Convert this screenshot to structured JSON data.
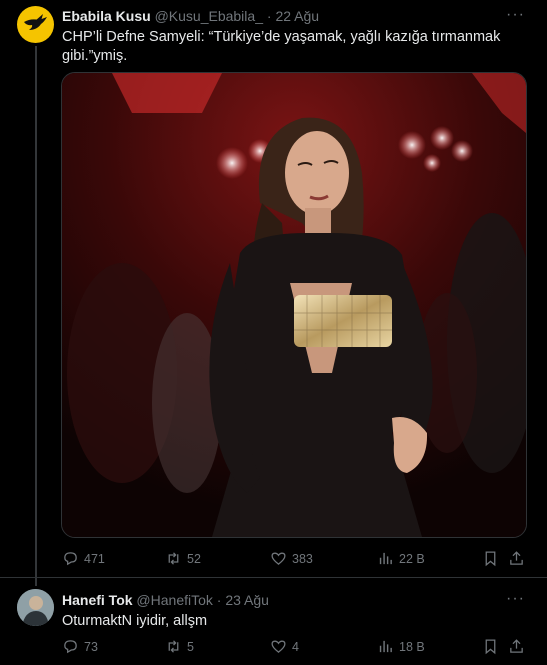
{
  "tweet1": {
    "name": "Ebabila Kusu",
    "handle": "@Kusu_Ebabila_",
    "date": "22 Ağu",
    "text_line1": "CHP’li Defne Samyeli: “Türkiye’de yaşamak, yağlı kazığa tırmanmak",
    "text_line2": "gibi.”ymiş.",
    "replies": "471",
    "retweets": "52",
    "likes": "383",
    "views": "22 B"
  },
  "tweet2": {
    "name": "Hanefi Tok",
    "handle": "@HanefiTok",
    "date": "23 Ağu",
    "text": "OturmaktN iyidir, allşm",
    "replies": "73",
    "retweets": "5",
    "likes": "4",
    "views": "18 B"
  },
  "ui": {
    "dot": "·",
    "more": "···"
  },
  "colors": {
    "background": "#000000",
    "text": "#e7e9ea",
    "secondary": "#71767b",
    "border": "#2f3336",
    "avatar1": "#f5c400"
  },
  "icons": [
    "reply-icon",
    "retweet-icon",
    "like-icon",
    "views-icon",
    "bookmark-icon",
    "share-icon",
    "more-icon"
  ]
}
